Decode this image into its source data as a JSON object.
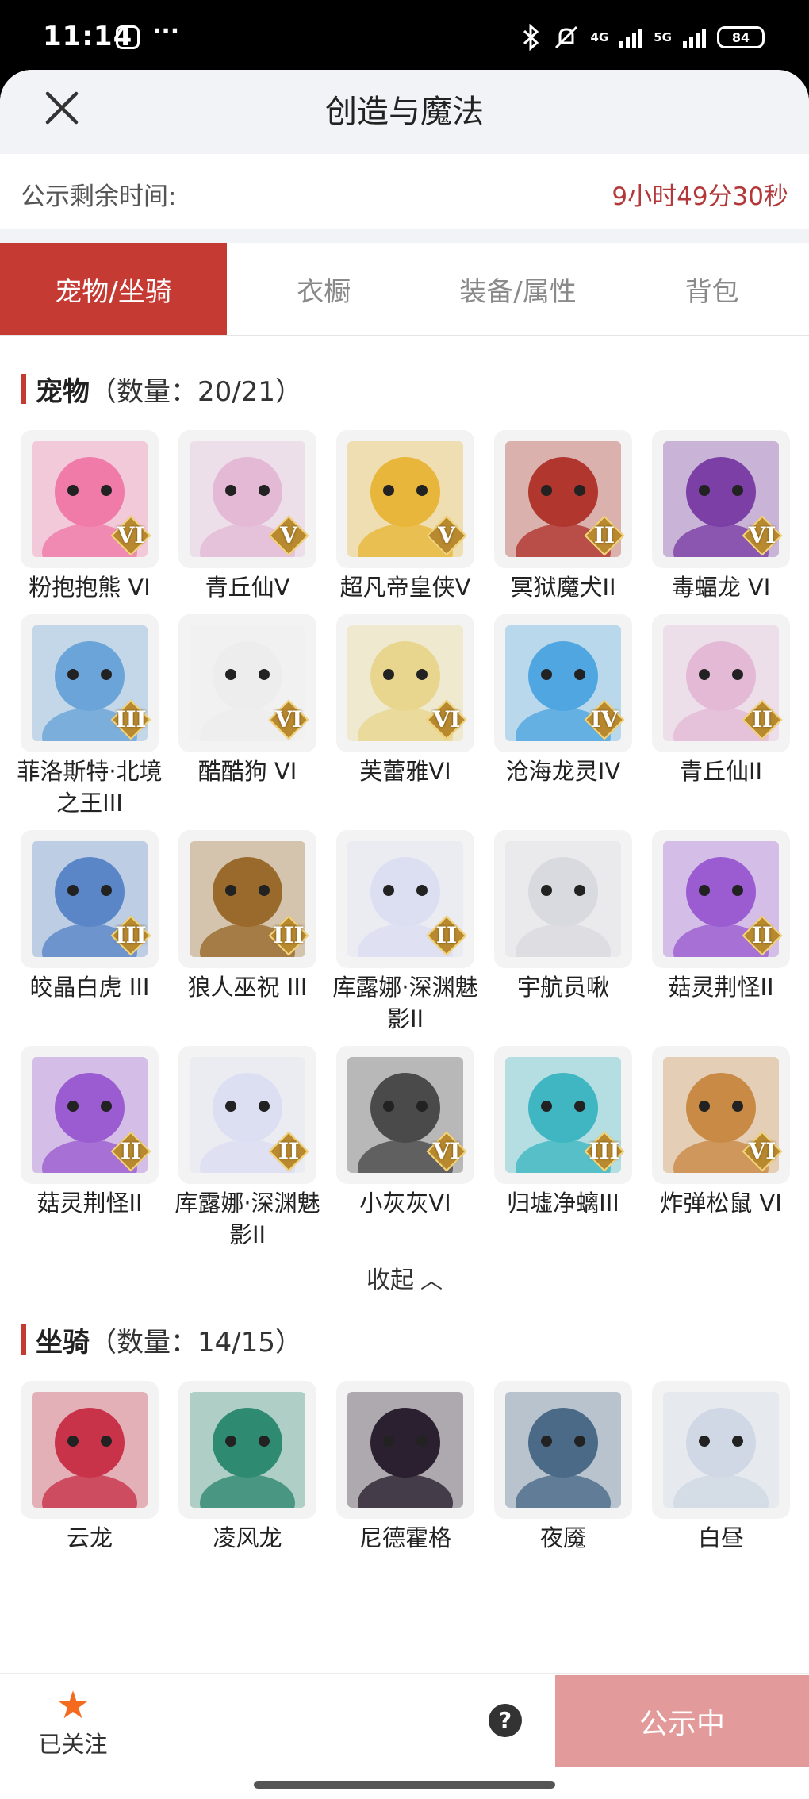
{
  "status_bar": {
    "time": "11:14",
    "dots": "···",
    "net1": "4G",
    "net2": "5G",
    "battery": "84"
  },
  "header": {
    "title": "创造与魔法"
  },
  "countdown": {
    "label": "公示剩余时间:",
    "value": "9小时49分30秒"
  },
  "tabs": [
    {
      "label": "宠物/坐骑",
      "active": true
    },
    {
      "label": "衣橱",
      "active": false
    },
    {
      "label": "装备/属性",
      "active": false
    },
    {
      "label": "背包",
      "active": false
    }
  ],
  "pets": {
    "title": "宠物",
    "count": "（数量：20/21）",
    "items": [
      {
        "name": "粉抱抱熊 VI",
        "badge": "VI",
        "color": "#f07aa8",
        "icon": "pink-bear-icon"
      },
      {
        "name": "青丘仙V",
        "badge": "V",
        "color": "#e3b9d6",
        "icon": "fox-fairy-icon"
      },
      {
        "name": "超凡帝皇侠V",
        "badge": "V",
        "color": "#e8b63a",
        "icon": "golden-hero-icon"
      },
      {
        "name": "冥狱魔犬II",
        "badge": "II",
        "color": "#b0362e",
        "icon": "hellhound-icon"
      },
      {
        "name": "毒蝠龙 VI",
        "badge": "VI",
        "color": "#7b3fa5",
        "icon": "bat-dragon-icon"
      },
      {
        "name": "菲洛斯特·北境之王III",
        "badge": "III",
        "color": "#6aa4d8",
        "icon": "frost-king-icon"
      },
      {
        "name": "酷酷狗 VI",
        "badge": "VI",
        "color": "#ededed",
        "icon": "cool-dog-icon"
      },
      {
        "name": "芙蕾雅VI",
        "badge": "VI",
        "color": "#e8d68f",
        "icon": "freya-icon"
      },
      {
        "name": "沧海龙灵IV",
        "badge": "IV",
        "color": "#4fa6e0",
        "icon": "sea-dragon-spirit-icon"
      },
      {
        "name": "青丘仙II",
        "badge": "II",
        "color": "#e3b9d6",
        "icon": "fox-fairy-icon"
      },
      {
        "name": "皎晶白虎 III",
        "badge": "III",
        "color": "#5a86c8",
        "icon": "white-tiger-icon"
      },
      {
        "name": "狼人巫祝 III",
        "badge": "III",
        "color": "#9a6a2c",
        "icon": "werewolf-shaman-icon"
      },
      {
        "name": "库露娜·深渊魅影II",
        "badge": "II",
        "color": "#dcdff2",
        "icon": "abyss-phantom-icon"
      },
      {
        "name": "宇航员啾",
        "badge": "",
        "color": "#d9d9e0",
        "icon": "astronaut-icon"
      },
      {
        "name": "菇灵荆怪II",
        "badge": "II",
        "color": "#9a5cd0",
        "icon": "mushroom-spirit-icon"
      },
      {
        "name": "菇灵荆怪II",
        "badge": "II",
        "color": "#9a5cd0",
        "icon": "mushroom-spirit-icon"
      },
      {
        "name": "库露娜·深渊魅影II",
        "badge": "II",
        "color": "#dcdff2",
        "icon": "abyss-phantom-icon"
      },
      {
        "name": "小灰灰VI",
        "badge": "VI",
        "color": "#4a4a4a",
        "icon": "grey-wolf-icon"
      },
      {
        "name": "归墟净螭III",
        "badge": "III",
        "color": "#3fb6c2",
        "icon": "water-dragon-icon"
      },
      {
        "name": "炸弹松鼠 VI",
        "badge": "VI",
        "color": "#c98a45",
        "icon": "bomb-squirrel-icon"
      }
    ]
  },
  "collapse_label": "收起",
  "mounts": {
    "title": "坐骑",
    "count": "（数量：14/15）",
    "items": [
      {
        "name": "云龙",
        "color": "#c8334a",
        "icon": "cloud-dragon-icon"
      },
      {
        "name": "凌风龙",
        "color": "#2f8a72",
        "icon": "wind-dragon-icon"
      },
      {
        "name": "尼德霍格",
        "color": "#2b2030",
        "icon": "nidhogg-icon"
      },
      {
        "name": "夜魇",
        "color": "#4a6a88",
        "icon": "nightmare-icon"
      },
      {
        "name": "白昼",
        "color": "#cfd8e4",
        "icon": "daylight-dragon-icon"
      }
    ]
  },
  "bottom_bar": {
    "follow_label": "已关注",
    "help": "?",
    "action_label": "公示中"
  }
}
